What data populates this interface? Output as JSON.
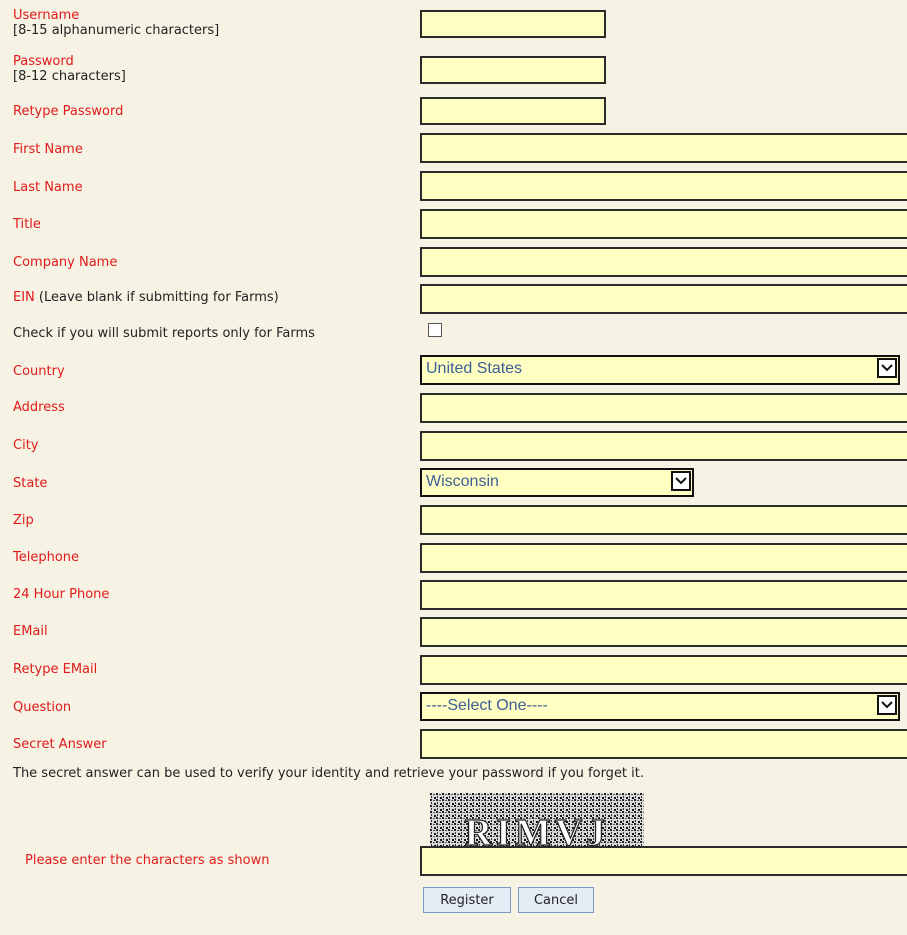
{
  "fields": {
    "username": {
      "label": "Username",
      "hint": "[8-15 alphanumeric characters]",
      "value": ""
    },
    "password": {
      "label": "Password",
      "hint": "[8-12 characters]",
      "value": ""
    },
    "retype_password": {
      "label": "Retype Password",
      "value": ""
    },
    "first_name": {
      "label": "First Name",
      "value": ""
    },
    "last_name": {
      "label": "Last Name",
      "value": ""
    },
    "title": {
      "label": "Title",
      "value": ""
    },
    "company_name": {
      "label": "Company Name",
      "value": ""
    },
    "ein": {
      "label": "EIN",
      "note": "(Leave blank if submitting for Farms)",
      "value": ""
    },
    "farms_only": {
      "label": "Check if you will submit reports only for Farms",
      "checked": false
    },
    "country": {
      "label": "Country",
      "value": "United States"
    },
    "address": {
      "label": "Address",
      "value": ""
    },
    "city": {
      "label": "City",
      "value": ""
    },
    "state": {
      "label": "State",
      "value": "Wisconsin"
    },
    "zip": {
      "label": "Zip",
      "value": ""
    },
    "telephone": {
      "label": "Telephone",
      "value": ""
    },
    "phone_24h": {
      "label": "24 Hour Phone",
      "value": ""
    },
    "email": {
      "label": "EMail",
      "value": ""
    },
    "retype_email": {
      "label": "Retype EMail",
      "value": ""
    },
    "question": {
      "label": "Question",
      "value": "----Select One----"
    },
    "secret_answer": {
      "label": "Secret Answer",
      "value": ""
    }
  },
  "secret_answer_help": "The secret answer can be used to verify your identity and retrieve your password if you forget it.",
  "captcha": {
    "text": "RIMVJ",
    "prompt": "Please enter the characters as shown",
    "value": ""
  },
  "buttons": {
    "register": "Register",
    "cancel": "Cancel"
  },
  "colors": {
    "label": "#e01b1b",
    "field_bg": "#ffffc4",
    "page_bg": "#f6f2e4",
    "select_text": "#3d5f96"
  },
  "icons": {
    "dropdown": "chevron-down-icon"
  }
}
